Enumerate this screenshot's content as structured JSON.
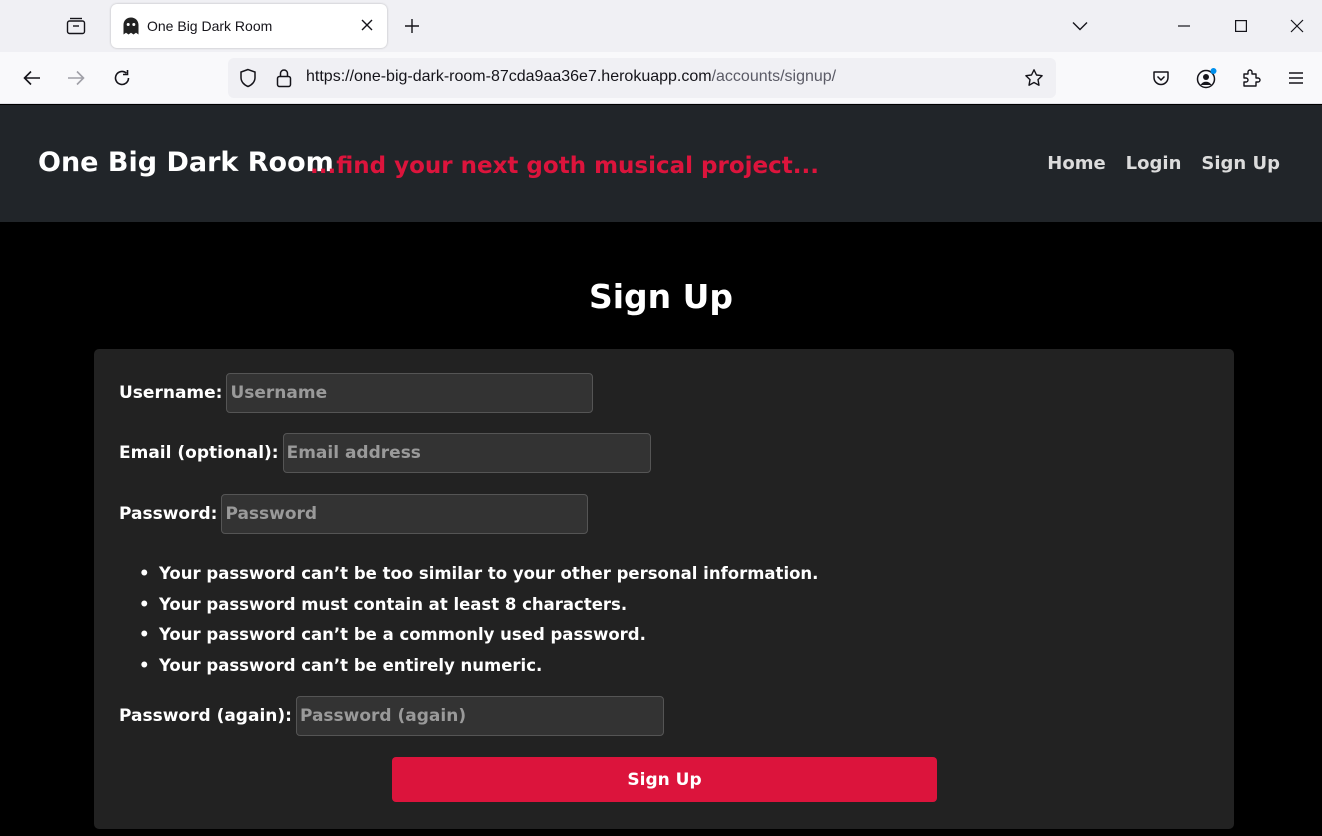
{
  "browser": {
    "tab_title": "One Big Dark Room",
    "url_host": "https://one-big-dark-room-87cda9aa36e7.herokuapp.com",
    "url_path": "/accounts/signup/"
  },
  "header": {
    "brand": "One Big Dark Room",
    "tagline": "...find your next goth musical project...",
    "nav": [
      {
        "label": "Home"
      },
      {
        "label": "Login"
      },
      {
        "label": "Sign Up"
      }
    ]
  },
  "main": {
    "title": "Sign Up",
    "form": {
      "username": {
        "label": "Username:",
        "placeholder": "Username"
      },
      "email": {
        "label": "Email (optional):",
        "placeholder": "Email address"
      },
      "password": {
        "label": "Password:",
        "placeholder": "Password"
      },
      "password_help": [
        "Your password can’t be too similar to your other personal information.",
        "Your password must contain at least 8 characters.",
        "Your password can’t be a commonly used password.",
        "Your password can’t be entirely numeric."
      ],
      "password2": {
        "label": "Password (again):",
        "placeholder": "Password (again)"
      },
      "submit_label": "Sign Up"
    }
  },
  "colors": {
    "accent": "#dc143c",
    "header_bg": "#212529",
    "card_bg": "#222222",
    "page_bg": "#000000"
  }
}
